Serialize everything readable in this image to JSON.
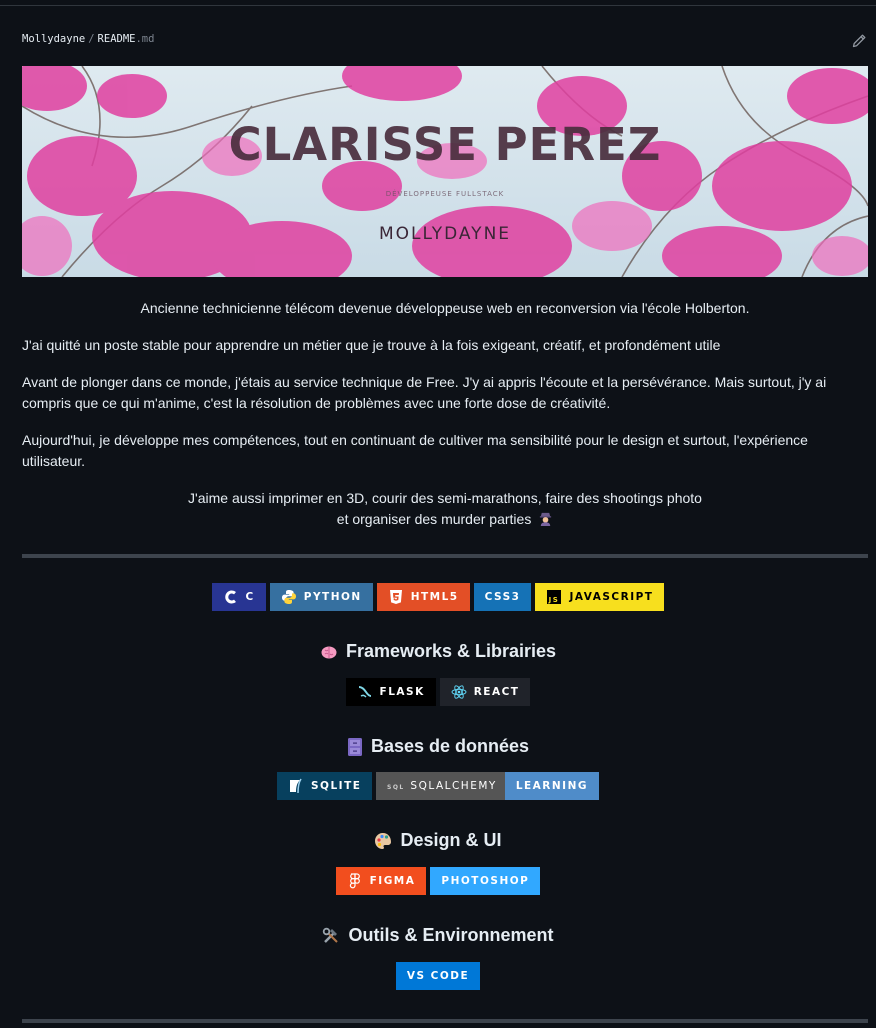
{
  "breadcrumb": {
    "owner": "Mollydayne",
    "separator": "/",
    "file": "README",
    "ext": ".md"
  },
  "banner": {
    "title": "CLARISSE PEREZ",
    "subtitle": "DÉVELOPPEUSE FULLSTACK",
    "handle": "MOLLYDAYNE"
  },
  "intro": "Ancienne technicienne télécom devenue développeuse web en reconversion via l'école Holberton.",
  "p1": "J'ai quitté un poste stable pour apprendre un métier que je trouve à la fois exigeant, créatif, et profondément utile",
  "p2": "Avant de plonger dans ce monde, j'étais au service technique de Free. J'y ai appris l'écoute et la persévérance. Mais surtout, j'y ai compris que ce qui m'anime, c'est la résolution de problèmes avec une forte dose de créativité.",
  "p3": "Aujourd'hui, je développe mes compétences, tout en continuant de cultiver ma sensibilité pour le design et surtout, l'expérience utilisateur.",
  "hobbies_line1": "J'aime aussi imprimer en 3D, courir des semi-marathons, faire des shootings photo",
  "hobbies_line2": "et organiser des murder parties",
  "languages": {
    "c": "C",
    "python": "PYTHON",
    "html5": "HTML5",
    "css3": "CSS3",
    "javascript": "JAVASCRIPT"
  },
  "frameworks": {
    "title": "Frameworks & Librairies",
    "flask": "FLASK",
    "react": "REACT"
  },
  "databases": {
    "title": "Bases de données",
    "sqlite": "SQLITE",
    "sqlalchemy": "SQLALCHEMY",
    "learning": "LEARNING"
  },
  "design": {
    "title": "Design & UI",
    "figma": "FIGMA",
    "photoshop": "PHOTOSHOP"
  },
  "tools": {
    "title": "Outils & Environnement",
    "vscode": "VS CODE"
  },
  "colors": {
    "background": "#0d1117",
    "c": "#283593",
    "python": "#3670A0",
    "html5": "#E34F26",
    "css3": "#1572B6",
    "javascript": "#F7DF1E",
    "flask": "#000000",
    "react": "#20232a",
    "sqlite": "#07405e",
    "sqlalchemy": "#555555",
    "learning": "#4f8cc9",
    "figma": "#F24E1E",
    "photoshop": "#31A8FF",
    "vscode": "#0078d7"
  }
}
